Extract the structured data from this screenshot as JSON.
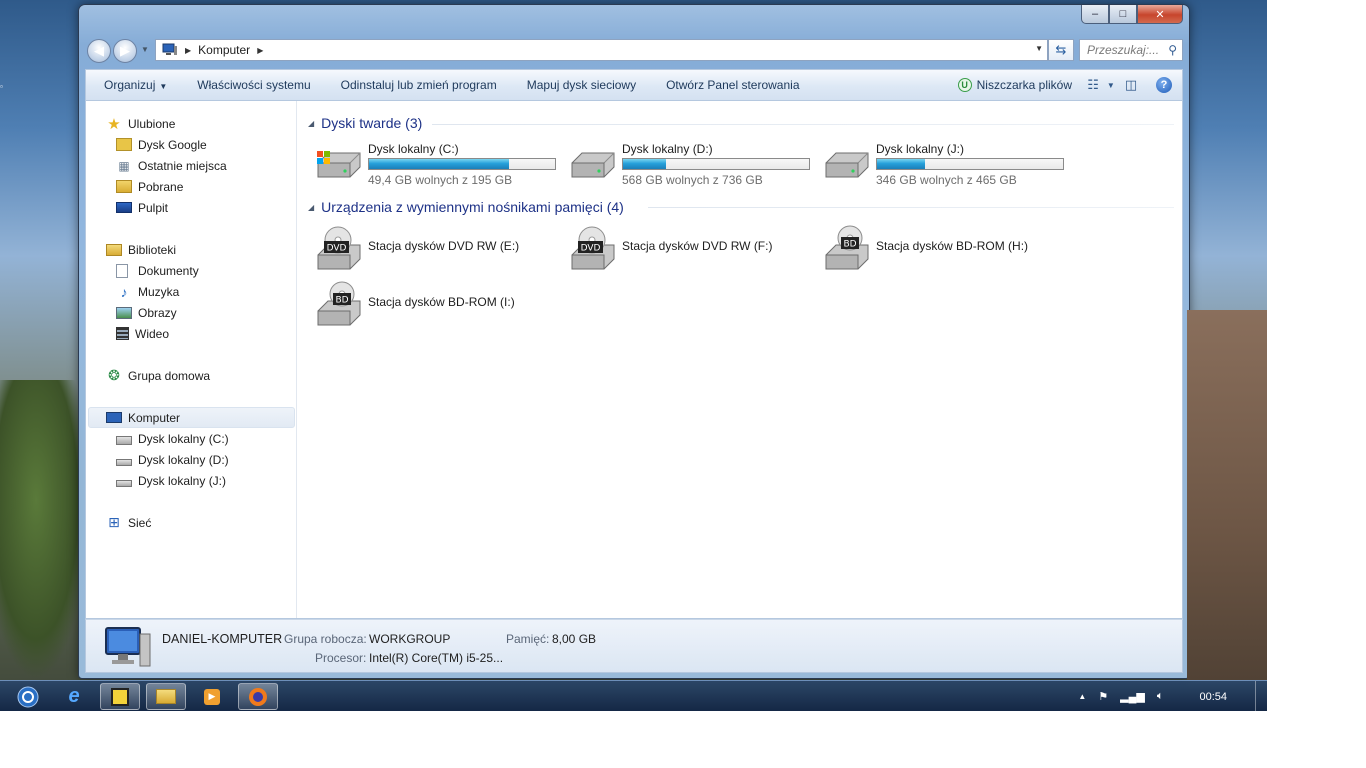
{
  "window": {
    "caption_buttons": {
      "minimize": "–",
      "maximize": "□",
      "close": "✕"
    },
    "address": {
      "crumbs": [
        "Komputer"
      ]
    },
    "search": {
      "placeholder": "Przeszukaj:..."
    }
  },
  "toolbar": {
    "items": [
      {
        "label": "Organizuj",
        "has_dropdown": true
      },
      {
        "label": "Właściwości systemu"
      },
      {
        "label": "Odinstaluj lub zmień program"
      },
      {
        "label": "Mapuj dysk sieciowy"
      },
      {
        "label": "Otwórz Panel sterowania"
      }
    ],
    "shredder": {
      "badge": "U",
      "label": "Niszczarka plików"
    }
  },
  "sidebar": {
    "favorites": {
      "label": "Ulubione",
      "items": [
        "Dysk Google",
        "Ostatnie miejsca",
        "Pobrane",
        "Pulpit"
      ]
    },
    "libraries": {
      "label": "Biblioteki",
      "items": [
        "Dokumenty",
        "Muzyka",
        "Obrazy",
        "Wideo"
      ]
    },
    "homegroup": {
      "label": "Grupa domowa"
    },
    "computer": {
      "label": "Komputer",
      "items": [
        "Dysk lokalny (C:)",
        "Dysk lokalny (D:)",
        "Dysk lokalny (J:)"
      ]
    },
    "network": {
      "label": "Sieć"
    }
  },
  "content": {
    "hard_drives": {
      "header": "Dyski twarde (3)",
      "drives": [
        {
          "name": "Dysk lokalny (C:)",
          "free": "49,4 GB wolnych z 195 GB",
          "used_fraction": 0.75,
          "system": true
        },
        {
          "name": "Dysk lokalny (D:)",
          "free": "568 GB wolnych z 736 GB",
          "used_fraction": 0.23
        },
        {
          "name": "Dysk lokalny (J:)",
          "free": "346 GB wolnych z 465 GB",
          "used_fraction": 0.26
        }
      ]
    },
    "removable": {
      "header": "Urządzenia z wymiennymi nośnikami pamięci (4)",
      "drives": [
        {
          "name": "Stacja dysków DVD RW (E:)",
          "badge": "DVD"
        },
        {
          "name": "Stacja dysków DVD RW (F:)",
          "badge": "DVD"
        },
        {
          "name": "Stacja dysków BD-ROM (H:)",
          "badge": "BD"
        },
        {
          "name": "Stacja dysków BD-ROM (I:)",
          "badge": "BD"
        }
      ]
    }
  },
  "details": {
    "computer_name": "DANIEL-KOMPUTER",
    "workgroup_label": "Grupa robocza:",
    "workgroup": "WORKGROUP",
    "memory_label": "Pamięć:",
    "memory": "8,00 GB",
    "processor_label": "Procesor:",
    "processor": "Intel(R) Core(TM) i5-25..."
  },
  "taskbar": {
    "clock": "00:54"
  },
  "colors": {
    "accent_bar": "#26a0da",
    "group_header": "#1e3287"
  }
}
